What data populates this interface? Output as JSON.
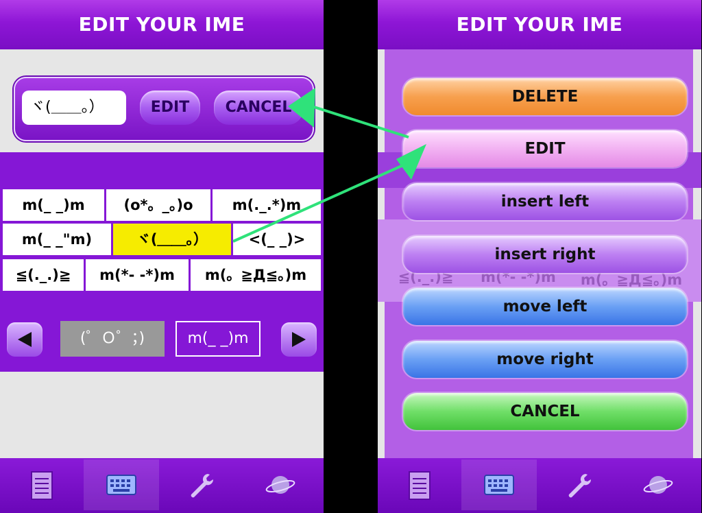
{
  "left_screen": {
    "title": "EDIT YOUR IME",
    "input_value": "ヾ(＿＿。）",
    "edit_button": "EDIT",
    "cancel_button": "CANCEL",
    "grid_rows": [
      [
        "m(_ _)m",
        "(o*。_。)o",
        "m(._.*)m"
      ],
      [
        "m(_ _\"m)",
        "ヾ(＿＿。）",
        "<(_ _)>"
      ],
      [
        "≦(._.)≧",
        "m(*- -*)m",
        "m(。≧Д≦。)m"
      ]
    ],
    "selected_cell": "ヾ(＿＿。）",
    "preview_prev": "(゜Ｏ゜；)",
    "preview_next": "m(_ _)m"
  },
  "right_screen": {
    "title": "EDIT YOUR IME",
    "menu": [
      {
        "label": "DELETE",
        "color": "#f7a04e"
      },
      {
        "label": "EDIT",
        "color": "#f0a2f0"
      },
      {
        "label": "insert left",
        "color": "#b877f0"
      },
      {
        "label": "insert right",
        "color": "#b877f0"
      },
      {
        "label": "move left",
        "color": "#4f8ef0"
      },
      {
        "label": "move right",
        "color": "#4f8ef0"
      },
      {
        "label": "CANCEL",
        "color": "#5cd65a"
      }
    ],
    "ghost_row": [
      "≦(._.)≧",
      "m(*- -*)m",
      "m(。≧Д≦。)m"
    ]
  },
  "tabs": [
    {
      "icon": "notepad-icon"
    },
    {
      "icon": "keyboard-icon",
      "active": true
    },
    {
      "icon": "wrench-icon"
    },
    {
      "icon": "planet-icon"
    }
  ],
  "colors": {
    "accent": "#8517d6",
    "highlight": "#f6ec00",
    "arrow": "#2fe27a"
  }
}
